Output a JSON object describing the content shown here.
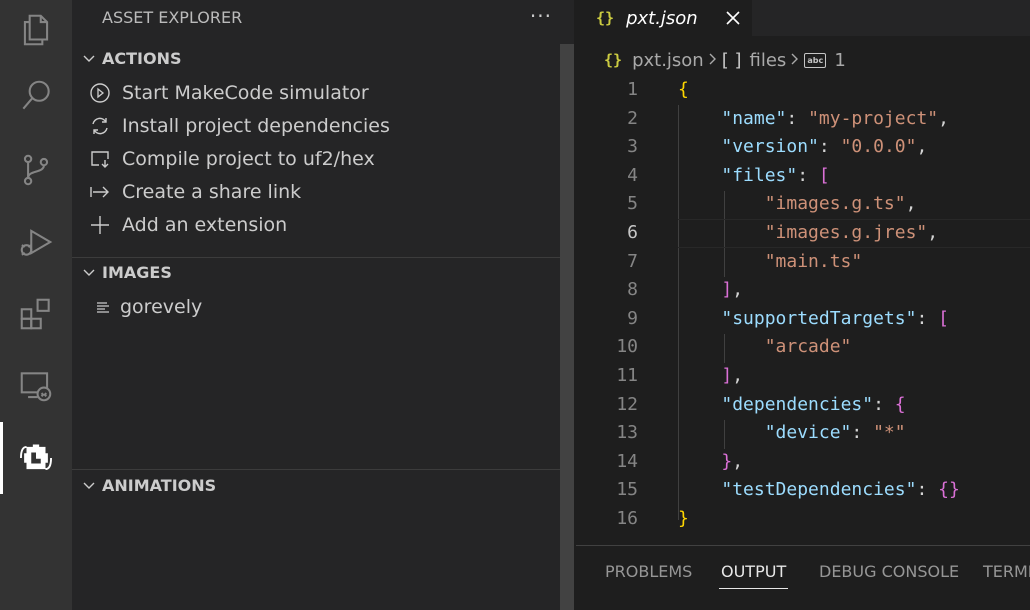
{
  "activity_bar": {
    "items": [
      {
        "icon": "files-icon",
        "active": false
      },
      {
        "icon": "search-icon",
        "active": false
      },
      {
        "icon": "source-control-icon",
        "active": false
      },
      {
        "icon": "run-debug-icon",
        "active": false
      },
      {
        "icon": "extensions-icon",
        "active": false
      },
      {
        "icon": "remote-explorer-icon",
        "active": false
      },
      {
        "icon": "makecode-asset-icon",
        "active": true
      }
    ]
  },
  "sidebar": {
    "title": "ASSET EXPLORER",
    "more": "···",
    "sections": {
      "actions": {
        "label": "ACTIONS",
        "items": [
          {
            "icon": "play-circle-icon",
            "label": "Start MakeCode simulator"
          },
          {
            "icon": "refresh-icon",
            "label": "Install project dependencies"
          },
          {
            "icon": "compile-icon",
            "label": "Compile project to uf2/hex"
          },
          {
            "icon": "share-arrow-icon",
            "label": "Create a share link"
          },
          {
            "icon": "plus-icon",
            "label": "Add an extension"
          }
        ]
      },
      "images": {
        "label": "IMAGES",
        "items": [
          {
            "icon": "list-icon",
            "label": "gorevely"
          }
        ]
      },
      "animations": {
        "label": "ANIMATIONS"
      }
    }
  },
  "editor": {
    "tab": {
      "icon_text": "{}",
      "filename": "pxt.json"
    },
    "breadcrumb": {
      "file": "pxt.json",
      "array_icon_text": "[ ]",
      "key": "files",
      "item_icon_text": "abc",
      "index": "1"
    },
    "current_line": 6,
    "lines": [
      {
        "n": "1",
        "tokens": [
          {
            "t": "{",
            "c": "b1"
          }
        ]
      },
      {
        "n": "2",
        "tokens": [
          {
            "t": "    ",
            "c": "p"
          },
          {
            "t": "\"name\"",
            "c": "k"
          },
          {
            "t": ": ",
            "c": "p"
          },
          {
            "t": "\"my-project\"",
            "c": "s"
          },
          {
            "t": ",",
            "c": "p"
          }
        ]
      },
      {
        "n": "3",
        "tokens": [
          {
            "t": "    ",
            "c": "p"
          },
          {
            "t": "\"version\"",
            "c": "k"
          },
          {
            "t": ": ",
            "c": "p"
          },
          {
            "t": "\"0.0.0\"",
            "c": "s"
          },
          {
            "t": ",",
            "c": "p"
          }
        ]
      },
      {
        "n": "4",
        "tokens": [
          {
            "t": "    ",
            "c": "p"
          },
          {
            "t": "\"files\"",
            "c": "k"
          },
          {
            "t": ": ",
            "c": "p"
          },
          {
            "t": "[",
            "c": "b2"
          }
        ]
      },
      {
        "n": "5",
        "tokens": [
          {
            "t": "        ",
            "c": "p"
          },
          {
            "t": "\"images.g.ts\"",
            "c": "s"
          },
          {
            "t": ",",
            "c": "p"
          }
        ]
      },
      {
        "n": "6",
        "tokens": [
          {
            "t": "        ",
            "c": "p"
          },
          {
            "t": "\"images.g.jres\"",
            "c": "s"
          },
          {
            "t": ",",
            "c": "p"
          }
        ]
      },
      {
        "n": "7",
        "tokens": [
          {
            "t": "        ",
            "c": "p"
          },
          {
            "t": "\"main.ts\"",
            "c": "s"
          }
        ]
      },
      {
        "n": "8",
        "tokens": [
          {
            "t": "    ",
            "c": "p"
          },
          {
            "t": "]",
            "c": "b2"
          },
          {
            "t": ",",
            "c": "p"
          }
        ]
      },
      {
        "n": "9",
        "tokens": [
          {
            "t": "    ",
            "c": "p"
          },
          {
            "t": "\"supportedTargets\"",
            "c": "k"
          },
          {
            "t": ": ",
            "c": "p"
          },
          {
            "t": "[",
            "c": "b2"
          }
        ]
      },
      {
        "n": "10",
        "tokens": [
          {
            "t": "        ",
            "c": "p"
          },
          {
            "t": "\"arcade\"",
            "c": "s"
          }
        ]
      },
      {
        "n": "11",
        "tokens": [
          {
            "t": "    ",
            "c": "p"
          },
          {
            "t": "]",
            "c": "b2"
          },
          {
            "t": ",",
            "c": "p"
          }
        ]
      },
      {
        "n": "12",
        "tokens": [
          {
            "t": "    ",
            "c": "p"
          },
          {
            "t": "\"dependencies\"",
            "c": "k"
          },
          {
            "t": ": ",
            "c": "p"
          },
          {
            "t": "{",
            "c": "b2"
          }
        ]
      },
      {
        "n": "13",
        "tokens": [
          {
            "t": "        ",
            "c": "p"
          },
          {
            "t": "\"device\"",
            "c": "k"
          },
          {
            "t": ": ",
            "c": "p"
          },
          {
            "t": "\"*\"",
            "c": "s"
          }
        ]
      },
      {
        "n": "14",
        "tokens": [
          {
            "t": "    ",
            "c": "p"
          },
          {
            "t": "}",
            "c": "b2"
          },
          {
            "t": ",",
            "c": "p"
          }
        ]
      },
      {
        "n": "15",
        "tokens": [
          {
            "t": "    ",
            "c": "p"
          },
          {
            "t": "\"testDependencies\"",
            "c": "k"
          },
          {
            "t": ": ",
            "c": "p"
          },
          {
            "t": "{}",
            "c": "b2"
          }
        ]
      },
      {
        "n": "16",
        "tokens": [
          {
            "t": "}",
            "c": "b1"
          }
        ]
      }
    ]
  },
  "panel": {
    "tabs": [
      {
        "label": "PROBLEMS",
        "active": false
      },
      {
        "label": "OUTPUT",
        "active": true
      },
      {
        "label": "DEBUG CONSOLE",
        "active": false
      },
      {
        "label": "TERMINAL",
        "active": false
      }
    ]
  },
  "colors": {
    "activity_bar": "#333333",
    "sidebar": "#252526",
    "editor": "#1e1e1e",
    "json_icon": "#cbcb41",
    "string": "#ce9178",
    "key": "#9cdcfe"
  }
}
